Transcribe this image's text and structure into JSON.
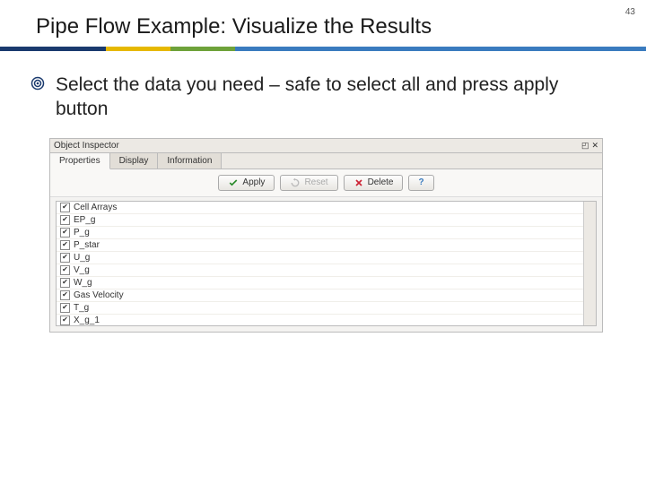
{
  "page_number": "43",
  "title": "Pipe Flow Example: Visualize the Results",
  "bullet": "Select the data you need – safe to select all and press apply button",
  "inspector": {
    "title": "Object Inspector",
    "tabs": [
      "Properties",
      "Display",
      "Information"
    ],
    "active_tab": 0,
    "buttons": {
      "apply": "Apply",
      "reset": "Reset",
      "delete": "Delete"
    },
    "arrays_header": "Cell Arrays",
    "arrays": [
      "EP_g",
      "P_g",
      "P_star",
      "U_g",
      "V_g",
      "W_g",
      "Gas Velocity",
      "T_g",
      "X_g_1"
    ]
  }
}
